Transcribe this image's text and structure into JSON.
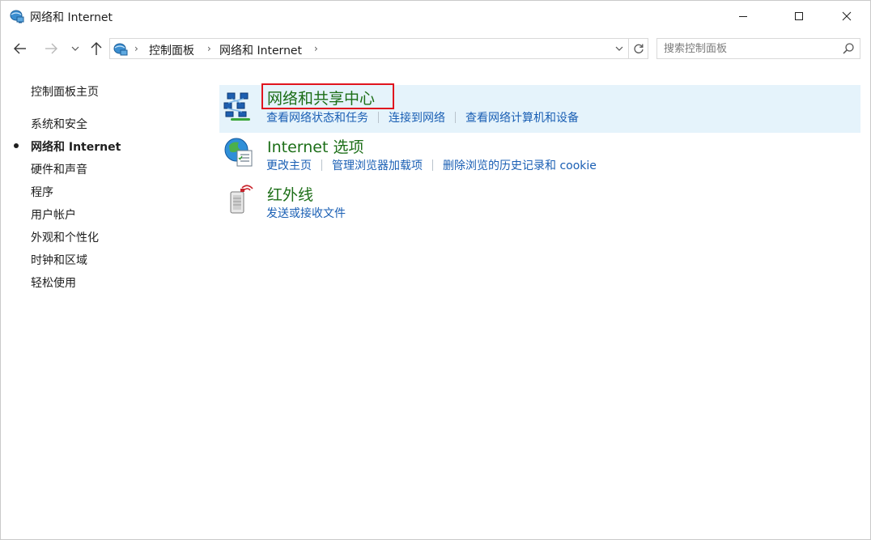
{
  "window": {
    "title": "网络和 Internet"
  },
  "address": {
    "crumbs": [
      "控制面板",
      "网络和 Internet"
    ]
  },
  "search": {
    "placeholder": "搜索控制面板"
  },
  "sidebar": {
    "home": "控制面板主页",
    "items": [
      {
        "label": "系统和安全",
        "active": false
      },
      {
        "label": "网络和 Internet",
        "active": true
      },
      {
        "label": "硬件和声音",
        "active": false
      },
      {
        "label": "程序",
        "active": false
      },
      {
        "label": "用户帐户",
        "active": false
      },
      {
        "label": "外观和个性化",
        "active": false
      },
      {
        "label": "时钟和区域",
        "active": false
      },
      {
        "label": "轻松使用",
        "active": false
      }
    ]
  },
  "categories": [
    {
      "title": "网络和共享中心",
      "icon": "network-sharing-icon",
      "links": [
        "查看网络状态和任务",
        "连接到网络",
        "查看网络计算机和设备"
      ]
    },
    {
      "title": "Internet 选项",
      "icon": "internet-options-icon",
      "links": [
        "更改主页",
        "管理浏览器加载项",
        "删除浏览的历史记录和 cookie"
      ]
    },
    {
      "title": "红外线",
      "icon": "infrared-icon",
      "links": [
        "发送或接收文件"
      ]
    }
  ],
  "colors": {
    "category_title": "#1c6e17",
    "link": "#1a5fb4",
    "highlight_bg": "#e5f3fb",
    "annotation_box": "#e0141e"
  }
}
